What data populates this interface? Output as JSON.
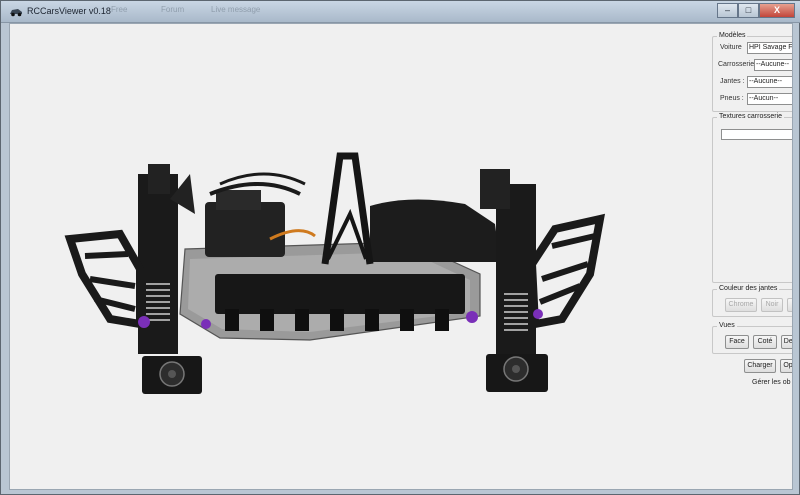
{
  "window": {
    "title": "RCCarsViewer v0.18",
    "background_tabs": [
      "Free",
      "Forum",
      "Live message"
    ],
    "buttons": {
      "minimize": "–",
      "maximize": "□",
      "close": "X"
    }
  },
  "panel": {
    "models": {
      "legend": "Modèles",
      "voiture_label": "Voiture",
      "voiture_value": "HPI Savage F",
      "carrosserie_label": "Carrosserie",
      "carrosserie_value": "--Aucune--",
      "jantes_label": "Jantes :",
      "jantes_value": "--Aucune--",
      "pneus_label": "Pneus :",
      "pneus_value": "--Aucun--"
    },
    "textures": {
      "legend": "Textures carrosserie"
    },
    "rim_color": {
      "legend": "Couleur des jantes",
      "chrome": "Chrome",
      "noir": "Noir"
    },
    "views": {
      "legend": "Vues",
      "face": "Face",
      "cote": "Coté",
      "dessus": "Des"
    },
    "charger": "Charger",
    "options": "Op",
    "gerer": "Gérer les ob"
  },
  "colors": {
    "accent_purple": "#7a2fb8",
    "chassis_plate": "#9a9a9a",
    "parts_black": "#1c1c1c"
  }
}
